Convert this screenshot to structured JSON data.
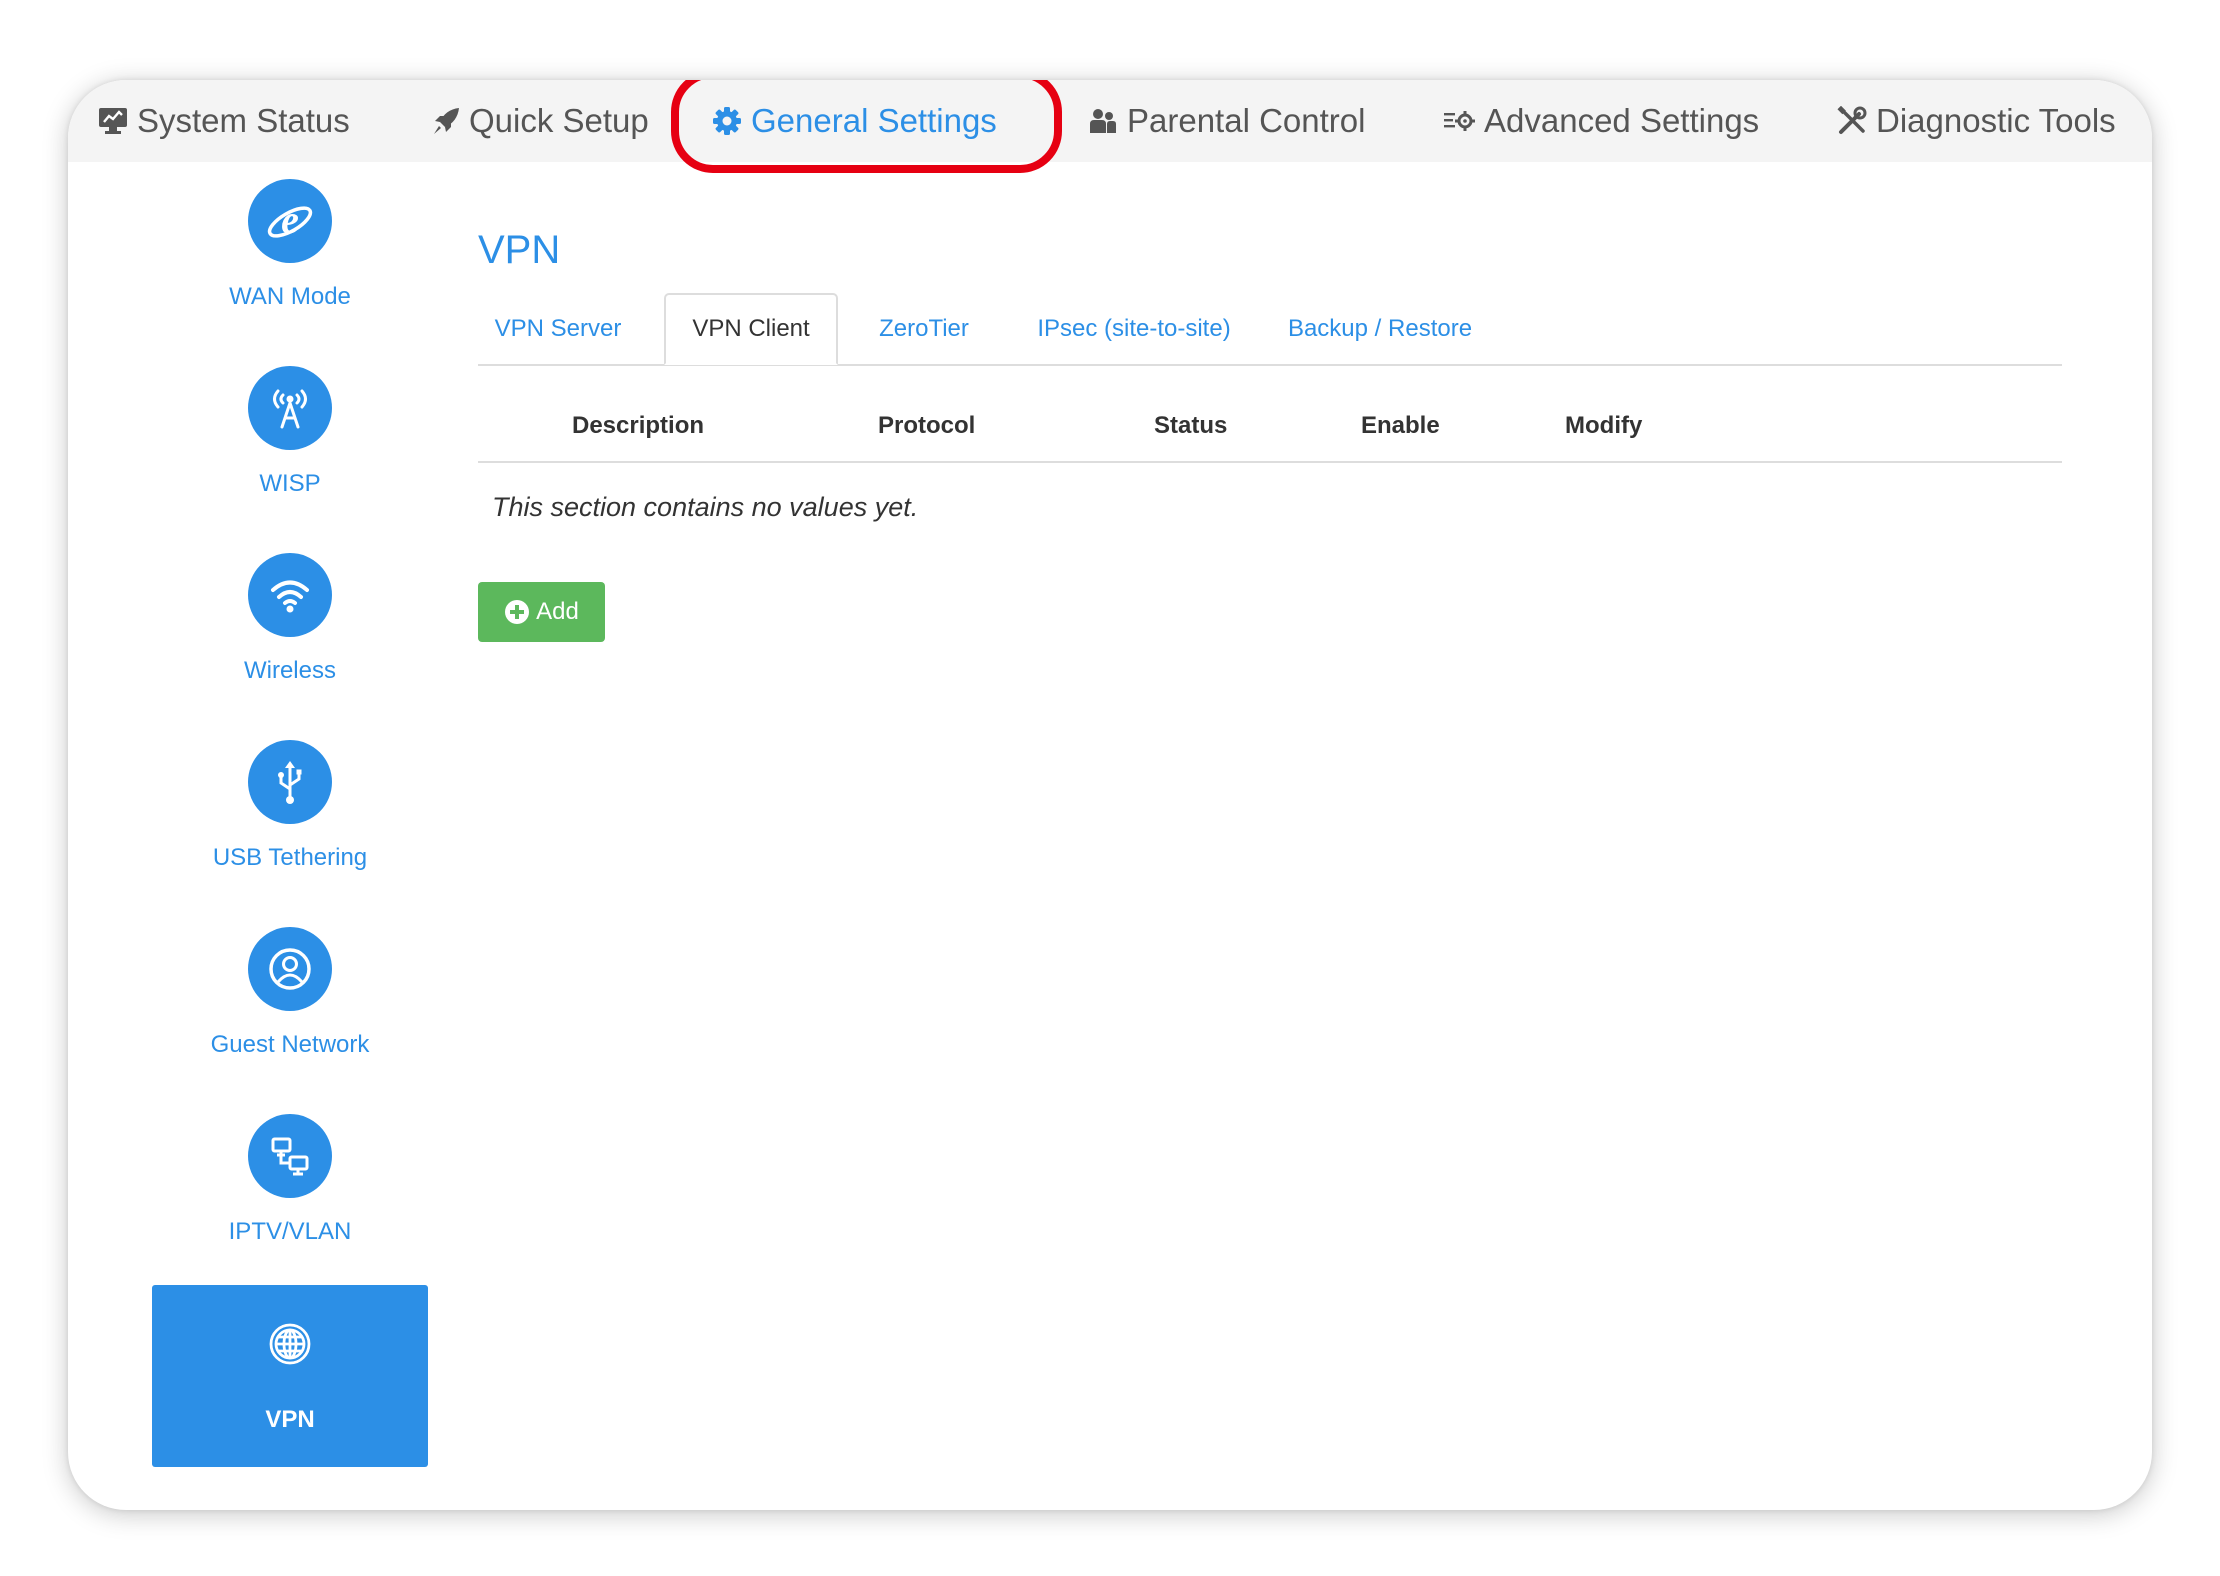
{
  "topnav": {
    "items": [
      {
        "label": "System Status",
        "icon": "monitor-icon"
      },
      {
        "label": "Quick Setup",
        "icon": "rocket-icon"
      },
      {
        "label": "General Settings",
        "icon": "gear-icon",
        "active": true
      },
      {
        "label": "Parental Control",
        "icon": "users-icon"
      },
      {
        "label": "Advanced Settings",
        "icon": "settings-list-icon"
      },
      {
        "label": "Diagnostic Tools",
        "icon": "tools-icon"
      }
    ]
  },
  "sidebar": {
    "items": [
      {
        "label": "WAN Mode",
        "icon": "internet-explorer-icon"
      },
      {
        "label": "WISP",
        "icon": "antenna-icon"
      },
      {
        "label": "Wireless",
        "icon": "wifi-icon"
      },
      {
        "label": "USB Tethering",
        "icon": "usb-icon"
      },
      {
        "label": "Guest Network",
        "icon": "guest-user-icon"
      },
      {
        "label": "IPTV/VLAN",
        "icon": "network-icon"
      },
      {
        "label": "VPN",
        "icon": "globe-icon",
        "active": true
      }
    ]
  },
  "main": {
    "title": "VPN",
    "tabs": [
      {
        "label": "VPN Server"
      },
      {
        "label": "VPN Client",
        "active": true
      },
      {
        "label": "ZeroTier"
      },
      {
        "label": "IPsec (site-to-site)"
      },
      {
        "label": "Backup / Restore"
      }
    ],
    "table": {
      "columns": [
        "Description",
        "Protocol",
        "Status",
        "Enable",
        "Modify"
      ],
      "empty_message": "This section contains no values yet."
    },
    "add_label": "Add"
  },
  "colors": {
    "accent": "#2c8fe6",
    "highlight": "#e60012",
    "add_button": "#5cb85c",
    "nav_background": "#f4f4f4"
  }
}
